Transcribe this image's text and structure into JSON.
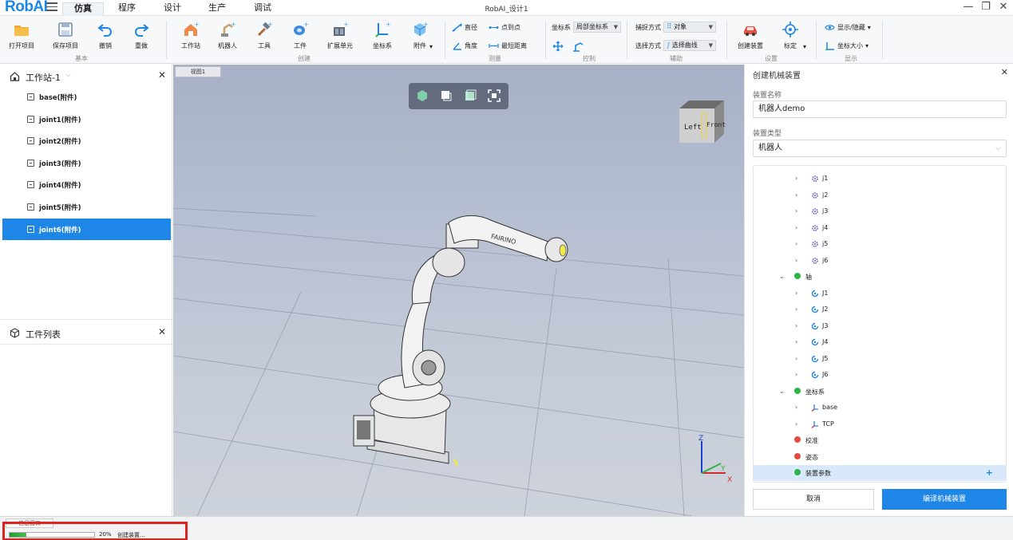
{
  "app": {
    "logo": "RobAI",
    "window_title": "RobAI_设计1",
    "tabs": [
      "仿真",
      "程序",
      "设计",
      "生产",
      "调试"
    ],
    "active_tab": "仿真"
  },
  "ribbon": {
    "basic": {
      "group": "基本",
      "open": "打开项目",
      "save": "保存项目",
      "undo": "撤销",
      "redo": "重做"
    },
    "create": {
      "group": "创建",
      "workstation": "工作站",
      "robot": "机器人",
      "tool": "工具",
      "workpiece": "工件",
      "ext_unit": "扩展单元",
      "frame": "坐标系",
      "attachment": "附件"
    },
    "measure": {
      "group": "测量",
      "diameter": "直径",
      "point_to_point": "点到点",
      "angle": "角度",
      "min_distance": "最短距离"
    },
    "control": {
      "group": "控制",
      "frame_label": "坐标系",
      "frame_value": "局部坐标系"
    },
    "assist": {
      "group": "辅助",
      "capture_label": "捕捉方式",
      "capture_value": "对象",
      "select_label": "选择方式",
      "select_value": "选择曲线"
    },
    "settings": {
      "group": "设置",
      "create_device": "创建装置",
      "calibrate": "标定"
    },
    "display": {
      "group": "显示",
      "show_hide": "显示/隐藏",
      "frame_size": "坐标大小"
    }
  },
  "left_panel": {
    "station_title": "工作站-1",
    "tree": [
      "base(附件)",
      "joint1(附件)",
      "joint2(附件)",
      "joint3(附件)",
      "joint4(附件)",
      "joint5(附件)",
      "joint6(附件)"
    ],
    "selected_index": 6,
    "workpiece_list_title": "工件列表"
  },
  "viewport": {
    "tab_label": "视图1",
    "navcube": {
      "left": "Left",
      "front": "Front"
    },
    "axes": {
      "x": "X",
      "y": "Y",
      "z": "Z"
    }
  },
  "right_panel": {
    "title": "创建机械装置",
    "name_label": "装置名称",
    "name_value": "机器人demo",
    "type_label": "装置类型",
    "type_value": "机器人",
    "tree": {
      "links": [
        "j1",
        "j2",
        "j3",
        "j4",
        "j5",
        "j6"
      ],
      "axes_group": "轴",
      "axes": [
        "J1",
        "J2",
        "J3",
        "J4",
        "J5",
        "J6"
      ],
      "frames_group": "坐标系",
      "frames": [
        "base",
        "TCP"
      ],
      "calibration": "校准",
      "pose": "姿态",
      "device_params": "装置参数"
    },
    "status_colors": {
      "ok": "#2eb24a",
      "error": "#e54b3c"
    },
    "cancel": "取消",
    "compile": "编译机械装置"
  },
  "status_bar": {
    "tab_label": "信息窗口",
    "progress": 0.2,
    "progress_text": "20%",
    "message": "创建装置..."
  }
}
